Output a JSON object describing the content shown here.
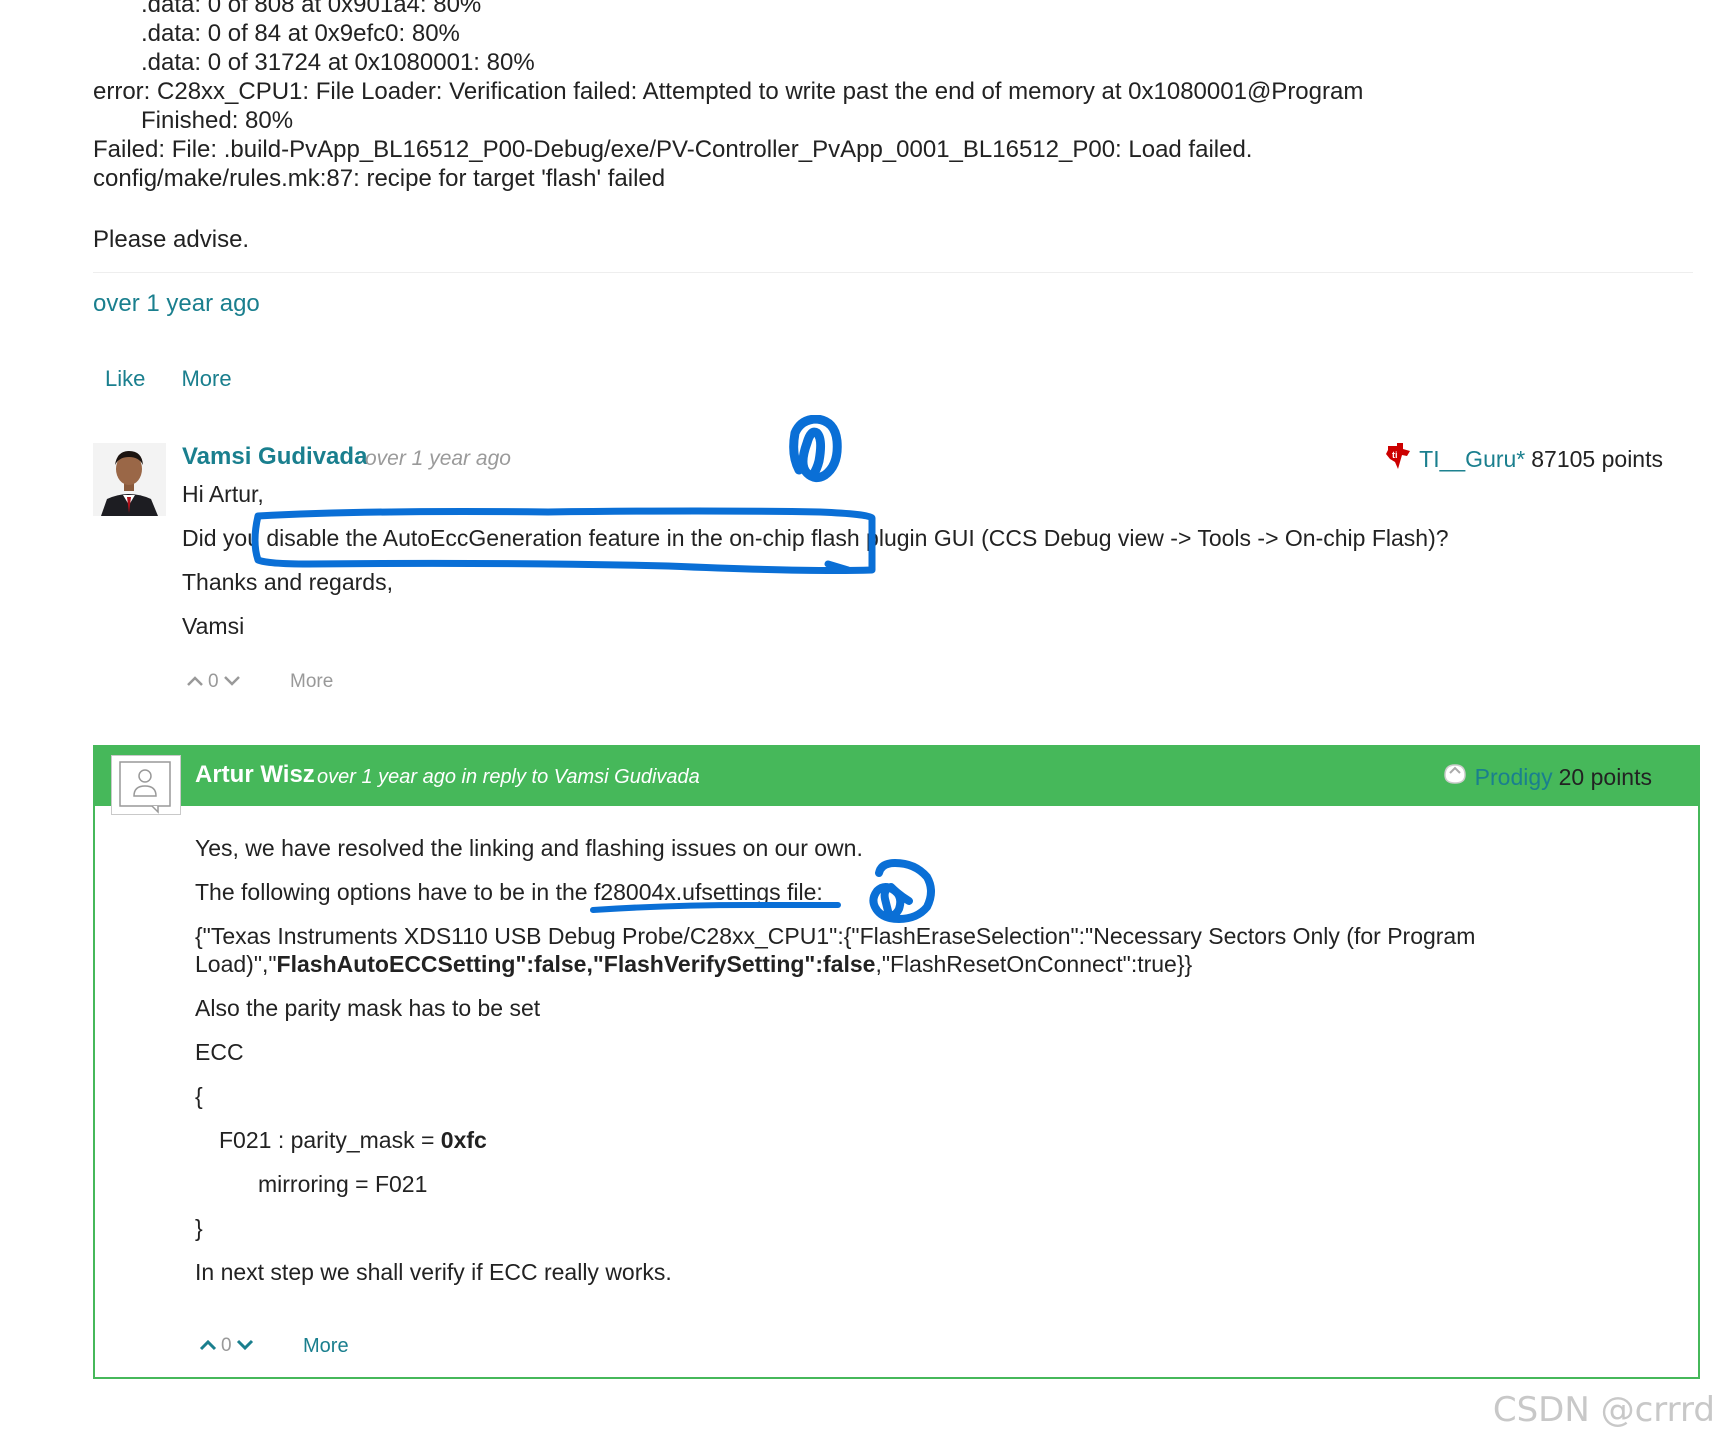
{
  "log": {
    "lines": [
      ".data: 0 of 808 at 0x901a4: 80%",
      ".data: 0 of 84 at 0x9efc0: 80%",
      ".data: 0 of 31724 at 0x1080001: 80%",
      "error: C28xx_CPU1: File Loader: Verification failed: Attempted to write past the end of memory at 0x1080001@Program",
      "Finished: 80%",
      "Failed: File: .build-PvApp_BL16512_P00-Debug/exe/PV-Controller_PvApp_0001_BL16512_P00: Load failed.",
      "config/make/rules.mk:87: recipe for target 'flash' failed"
    ]
  },
  "post": {
    "advise": "Please advise.",
    "timestamp": "over 1 year ago",
    "like_label": "Like",
    "more_label": "More"
  },
  "reply1": {
    "author": "Vamsi Gudivada",
    "time": "over 1 year ago",
    "rank_name": "TI__Guru*",
    "points": "87105 points",
    "greeting": "Hi Artur,",
    "q_pre": "Did you ",
    "q_mid": "disable the AutoEccGeneration feature in the on-chip flash",
    "q_post": " plugin GUI (CCS Debug view -> Tools -> On-chip Flash)?",
    "regards": "Thanks and regards,",
    "signature": "Vamsi",
    "votes": "0",
    "more_label": "More"
  },
  "reply2": {
    "author": "Artur Wisz",
    "time": "over 1 year ago in reply to Vamsi Gudivada",
    "rank_name": "Prodigy",
    "points": "20 points",
    "line1": "Yes, we have resolved the linking and flashing issues on our own.",
    "line2_pre": "The following options have to be in the ",
    "line2_file": "f28004x.ufsettings file:",
    "json_part1": "{\"Texas Instruments XDS110 USB Debug Probe/C28xx_CPU1\":{\"FlashEraseSelection\":\"Necessary Sectors Only (for Program Load)\",\"",
    "json_bold1": "FlashAutoECCSetting\":false,\"FlashVerifySetting\":false",
    "json_part2": ",\"FlashResetOnConnect\":true}}",
    "line4": "Also the parity mask has to be set",
    "line5": "ECC",
    "line6": "{",
    "line7_pre": "F021 : parity_mask = ",
    "line7_bold": "0xfc",
    "line8": "mirroring = F021",
    "line9": "}",
    "line10": "In next step we shall verify if ECC really works.",
    "votes": "0",
    "more_label": "More"
  },
  "watermark": "CSDN @crrrd",
  "colors": {
    "link_teal": "#1a7f8e",
    "reply_green": "#46b85a",
    "annotation_blue": "#0a6fd6"
  },
  "icons": [
    "ti-logo-icon",
    "prodigy-badge-icon",
    "vote-up-icon",
    "vote-down-icon",
    "user-placeholder-icon"
  ]
}
